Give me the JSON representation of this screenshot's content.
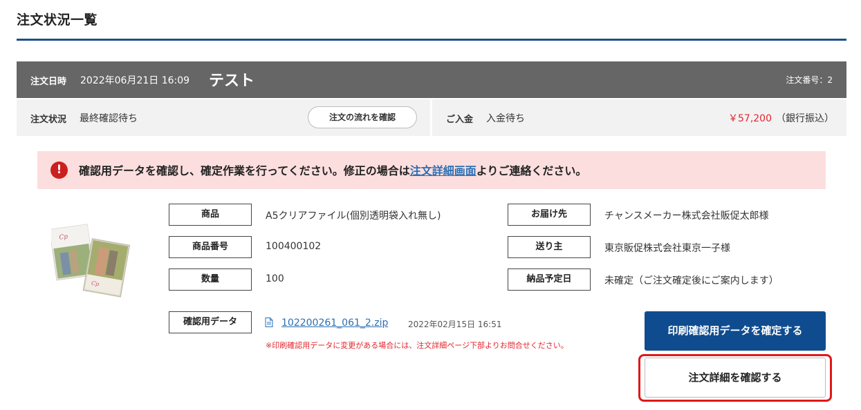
{
  "page": {
    "title": "注文状況一覧"
  },
  "order": {
    "date_label": "注文日時",
    "date": "2022年06月21日 16:09",
    "name": "テスト",
    "number": "注文番号：2"
  },
  "status": {
    "label": "注文状況",
    "value": "最終確認待ち",
    "flow_button": "注文の流れを確認",
    "payment_label": "ご入金",
    "payment_value": "入金待ち",
    "amount": "￥57,200",
    "method": "（銀行振込）"
  },
  "alert": {
    "text_before": "確認用データを確認し、確定作業を行ってください。修正の場合は",
    "link": "注文詳細画面",
    "text_after": "よりご連絡ください。"
  },
  "details": {
    "product_label": "商品",
    "product_value": "A5クリアファイル(個別透明袋入れ無し)",
    "code_label": "商品番号",
    "code_value": "100400102",
    "qty_label": "数量",
    "qty_value": "100",
    "dest_label": "お届け先",
    "dest_value": "チャンスメーカー株式会社販促太郎様",
    "sender_label": "送り主",
    "sender_value": "東京販促株式会社東京一子様",
    "delivery_label": "納品予定日",
    "delivery_value": "未確定（ご注文確定後にご案内します）"
  },
  "proof": {
    "label": "確認用データ",
    "file": "102200261_061_2.zip",
    "date": "2022年02月15日 16:51",
    "note": "※印刷確認用データに変更がある場合には、注文詳細ページ下部よりお問合せください。"
  },
  "buttons": {
    "confirm": "印刷確認用データを確定する",
    "detail": "注文詳細を確認する"
  },
  "colors": {
    "accent_blue": "#0f4c8f",
    "price_red": "#e0262e",
    "alert_bg": "#fddede",
    "header_gray": "#666666"
  }
}
